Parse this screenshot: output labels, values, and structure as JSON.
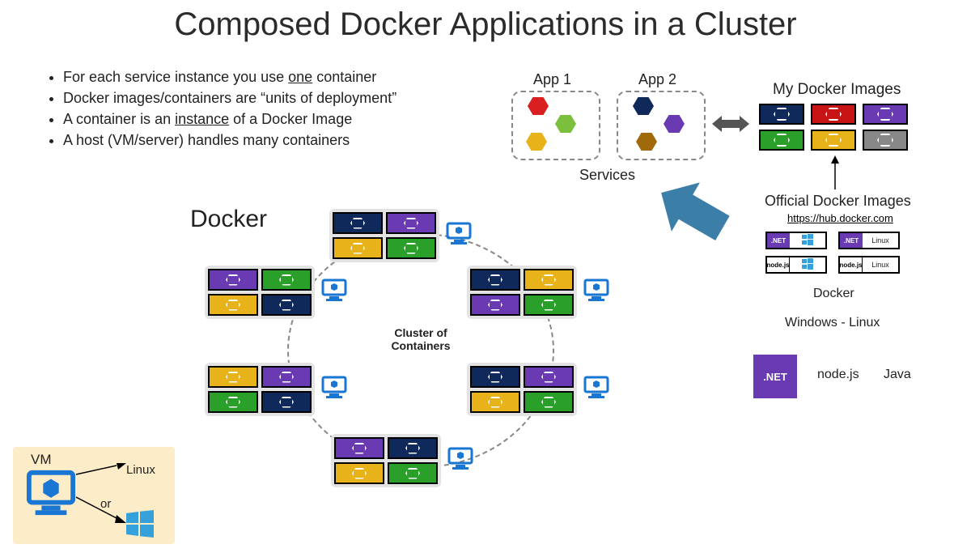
{
  "title": "Composed Docker Applications in a Cluster",
  "bullets": [
    "For each service instance you use <u>one</u> container",
    "Docker images/containers are \"units of deployment\"",
    "A container is an <u>instance</u> of a Docker Image",
    "A host (VM/server) handles many containers"
  ],
  "bullet_plain": {
    "b0a": "For each service instance you use ",
    "b0b": "one",
    "b0c": " container",
    "b1": "Docker images/containers are “units of deployment”",
    "b2a": "A container is an ",
    "b2b": "instance",
    "b2c": " of a Docker Image",
    "b3": "A host (VM/server) handles many containers"
  },
  "apps": {
    "app1_label": "App 1",
    "app2_label": "App 2",
    "services_label": "Services",
    "app1_hex_colors": [
      "#d91f1f",
      "#7bbf3c",
      "#e8b21a"
    ],
    "app2_hex_colors": [
      "#0f2a5a",
      "#6a3ab2",
      "#a06a0b"
    ]
  },
  "my_images": {
    "title": "My Docker Images",
    "row1_colors": [
      "#0f2a5a",
      "#c81414",
      "#6a3ab2"
    ],
    "row2_colors": [
      "#2aa02a",
      "#e8b21a",
      "#888888"
    ]
  },
  "official": {
    "title": "Official Docker Images",
    "hub": "https://hub.docker.com",
    "cards": [
      {
        "badge": ".NET",
        "badge_bg": "#6a3ab2",
        "os": "win"
      },
      {
        "badge": ".NET",
        "badge_bg": "#6a3ab2",
        "os": "Linux"
      },
      {
        "badge": "node.js",
        "badge_bg": "#333",
        "os": "win"
      },
      {
        "badge": "node.js",
        "badge_bg": "#333",
        "os": "Linux"
      }
    ],
    "docker_label": "Docker",
    "os_line": "Windows  -  Linux",
    "platforms": {
      "dotnet": ".NET",
      "node": "node.js",
      "java": "Java"
    }
  },
  "cluster": {
    "docker_label": "Docker",
    "center_label": "Cluster of Containers",
    "node_palette": {
      "navy": "#0f2a5a",
      "purple": "#6a3ab2",
      "gold": "#e8b21a",
      "green": "#2aa02a"
    },
    "nodes": [
      {
        "pos": "top",
        "colors": [
          "navy",
          "purple",
          "gold",
          "green"
        ]
      },
      {
        "pos": "tl",
        "colors": [
          "purple",
          "green",
          "gold",
          "navy"
        ]
      },
      {
        "pos": "tr",
        "colors": [
          "navy",
          "gold",
          "purple",
          "green"
        ]
      },
      {
        "pos": "bl",
        "colors": [
          "gold",
          "purple",
          "green",
          "navy"
        ]
      },
      {
        "pos": "br",
        "colors": [
          "navy",
          "purple",
          "gold",
          "green"
        ]
      },
      {
        "pos": "bottom",
        "colors": [
          "purple",
          "navy",
          "gold",
          "green"
        ]
      }
    ]
  },
  "vm": {
    "label": "VM",
    "linux": "Linux",
    "or": "or"
  }
}
